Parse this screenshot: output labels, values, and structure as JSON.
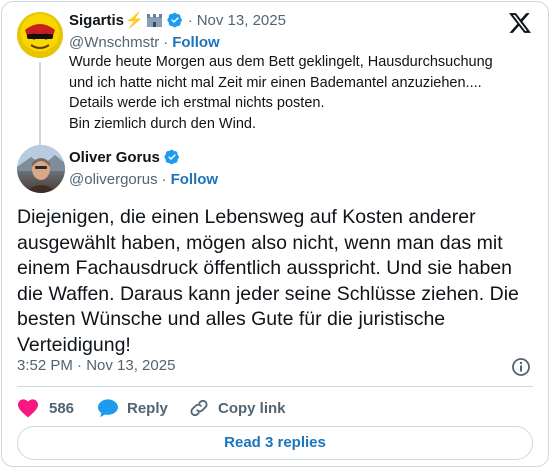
{
  "quoted": {
    "name": "Sigartis",
    "name_emoji": "⚡",
    "display_suffix_icon": "castle-icon",
    "handle": "@Wnschmstr",
    "sep": "·",
    "date": "Nov 13, 2025",
    "follow_label": "Follow",
    "text": "Wurde heute Morgen aus dem Bett geklingelt, Hausdurchsuchung\nund ich hatte nicht mal Zeit mir einen Bademantel anzuziehen....\nDetails werde ich erstmal nichts posten.\nBin ziemlich durch den Wind."
  },
  "author": {
    "name": "Oliver Gorus",
    "handle": "@olivergorus",
    "sep": "·",
    "follow_label": "Follow"
  },
  "post": {
    "text": "Diejenigen, die einen Lebensweg auf Kosten anderer ausgewählt haben, mögen also nicht, wenn man das mit einem Fachausdruck öffentlich ausspricht. Und sie haben die Waffen. Daraus kann jeder seine Schlüsse ziehen. Die besten Wünsche und alles Gute für die juristische Verteidigung!",
    "timestamp": "3:52 PM · Nov 13, 2025"
  },
  "actions": {
    "likes": "586",
    "reply_label": "Reply",
    "copy_link_label": "Copy link"
  },
  "read_replies_label": "Read 3 replies",
  "colors": {
    "accent": "#1d9bf0",
    "like": "#f91880",
    "link": "#1d74bb",
    "muted": "#536471"
  }
}
